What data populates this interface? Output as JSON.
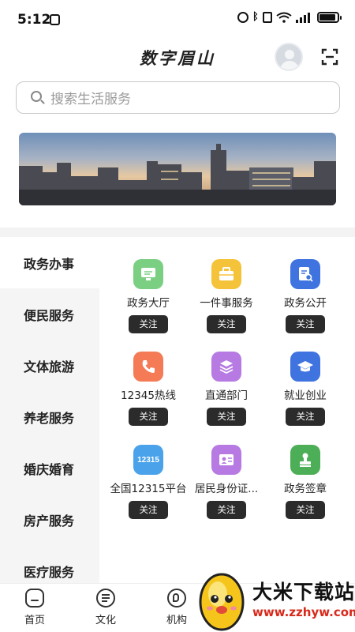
{
  "status_bar": {
    "time": "5:12"
  },
  "header": {
    "title": "数字眉山"
  },
  "search": {
    "placeholder": "搜索生活服务"
  },
  "categories": [
    {
      "label": "政务办事",
      "active": true
    },
    {
      "label": "便民服务",
      "active": false
    },
    {
      "label": "文体旅游",
      "active": false
    },
    {
      "label": "养老服务",
      "active": false
    },
    {
      "label": "婚庆婚育",
      "active": false
    },
    {
      "label": "房产服务",
      "active": false
    },
    {
      "label": "医疗服务",
      "active": false
    }
  ],
  "services": [
    {
      "label": "政务大厅",
      "button": "关注",
      "icon": "monitor-icon",
      "color": "#7bcf83"
    },
    {
      "label": "一件事服务",
      "button": "关注",
      "icon": "briefcase-icon",
      "color": "#f5c33a"
    },
    {
      "label": "政务公开",
      "button": "关注",
      "icon": "document-search-icon",
      "color": "#3f73e0"
    },
    {
      "label": "12345热线",
      "button": "关注",
      "icon": "phone-icon",
      "color": "#f47b55"
    },
    {
      "label": "直通部门",
      "button": "关注",
      "icon": "layers-icon",
      "color": "#b67ae2"
    },
    {
      "label": "就业创业",
      "button": "关注",
      "icon": "graduation-cap-icon",
      "color": "#3f73e0"
    },
    {
      "label": "全国12315平台",
      "button": "关注",
      "icon": "badge-12315-icon",
      "icon_text": "12315",
      "color": "#4aa3ea"
    },
    {
      "label": "居民身份证...",
      "button": "关注",
      "icon": "id-card-icon",
      "color": "#b67ae2"
    },
    {
      "label": "政务签章",
      "button": "关注",
      "icon": "stamp-icon",
      "color": "#4cae56"
    }
  ],
  "bottom_nav": [
    {
      "label": "首页",
      "icon": "home-icon"
    },
    {
      "label": "文化",
      "icon": "culture-icon"
    },
    {
      "label": "机构",
      "icon": "institution-icon"
    }
  ],
  "watermark": {
    "title": "大米下载站",
    "url": "www.zzhyw.com"
  }
}
